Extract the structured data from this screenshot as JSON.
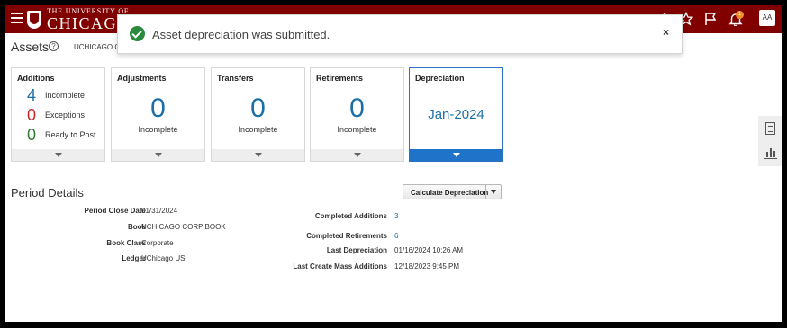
{
  "header": {
    "logo_line1": "THE UNIVERSITY OF",
    "logo_line2": "CHICAGO",
    "notification_count": "1",
    "avatar_initials": "AA",
    "colors": {
      "brand": "#800000"
    }
  },
  "page": {
    "title": "Assets",
    "book_selector": "UCHICAGO C"
  },
  "toast": {
    "message": "Asset depreciation was submitted.",
    "close": "×"
  },
  "infolets": {
    "additions": {
      "title": "Additions",
      "rows": [
        {
          "value": "4",
          "label": "Incomplete",
          "color": "#1a6fa8"
        },
        {
          "value": "0",
          "label": "Exceptions",
          "color": "#c62828"
        },
        {
          "value": "0",
          "label": "Ready to Post",
          "color": "#2e7d32"
        }
      ]
    },
    "adjustments": {
      "title": "Adjustments",
      "value": "0",
      "label": "Incomplete"
    },
    "transfers": {
      "title": "Transfers",
      "value": "0",
      "label": "Incomplete"
    },
    "retirements": {
      "title": "Retirements",
      "value": "0",
      "label": "Incomplete"
    },
    "depreciation": {
      "title": "Depreciation",
      "period": "Jan-2024"
    }
  },
  "period_details": {
    "title": "Period Details",
    "calculate_button": "Calculate Depreciation",
    "left": [
      {
        "label": "Period Close Date",
        "value": "01/31/2024"
      },
      {
        "label": "Book",
        "value": "UCHICAGO CORP BOOK"
      },
      {
        "label": "Book Class",
        "value": "Corporate"
      },
      {
        "label": "Ledger",
        "value": "UChicago US"
      }
    ],
    "right": [
      {
        "label": "Completed Additions",
        "value": "3"
      },
      {
        "label": "Completed Retirements",
        "value": "6"
      },
      {
        "label": "Last Depreciation",
        "value": "01/16/2024 10:26 AM"
      },
      {
        "label": "Last Create Mass Additions",
        "value": "12/18/2023 9:45 PM"
      }
    ]
  }
}
